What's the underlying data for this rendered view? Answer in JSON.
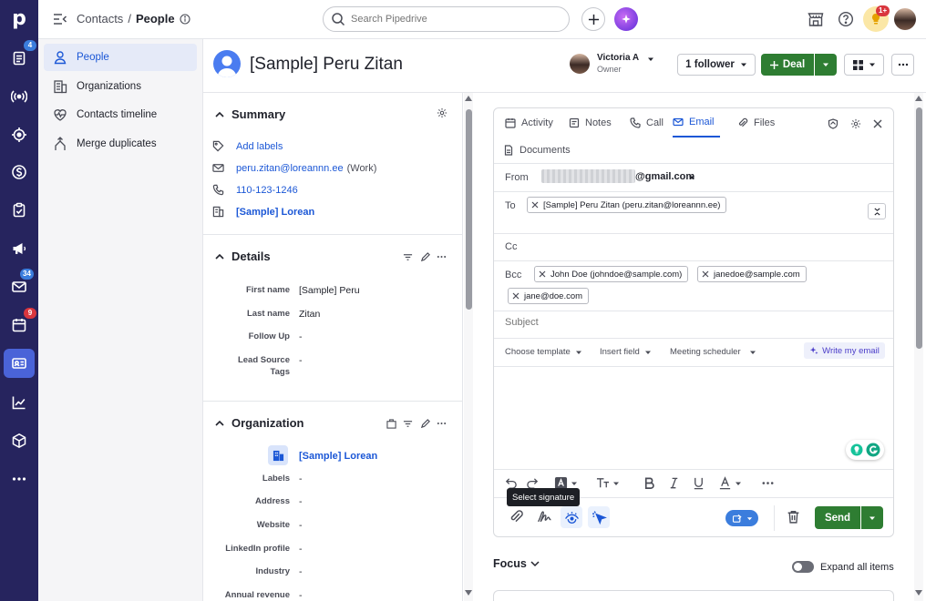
{
  "colors": {
    "rail": "#26245e",
    "accent": "#1b57d6",
    "primary_green": "#2e7d32",
    "badge_blue": "#3b7ddd",
    "badge_red": "#d9363e"
  },
  "rail": {
    "logo": "p",
    "badges": {
      "leads": "4",
      "mail": "34",
      "activities": "9"
    }
  },
  "topbar": {
    "breadcrumb_parent": "Contacts",
    "breadcrumb_sep": "/",
    "breadcrumb_current": "People",
    "search_placeholder": "Search Pipedrive",
    "notif_badge": "1+"
  },
  "subnav": {
    "items": [
      {
        "label": "People"
      },
      {
        "label": "Organizations"
      },
      {
        "label": "Contacts timeline"
      },
      {
        "label": "Merge duplicates"
      }
    ]
  },
  "header": {
    "title": "[Sample] Peru Zitan",
    "owner_name": "Victoria A",
    "owner_role": "Owner",
    "follower_label": "1 follower",
    "deal_label": "Deal"
  },
  "summary": {
    "title": "Summary",
    "add_labels": "Add labels",
    "email": "peru.zitan@loreannn.ee",
    "email_type": "(Work)",
    "phone": "110-123-1246",
    "org": "[Sample] Lorean"
  },
  "details": {
    "title": "Details",
    "fields": [
      {
        "label": "First name",
        "value": "[Sample] Peru"
      },
      {
        "label": "Last name",
        "value": "Zitan"
      },
      {
        "label": "Follow Up",
        "value": "-"
      },
      {
        "label": "Lead Source",
        "label2": "Tags",
        "value": "-"
      }
    ]
  },
  "organization": {
    "title": "Organization",
    "name": "[Sample] Lorean",
    "fields": [
      {
        "label": "Labels",
        "value": "-"
      },
      {
        "label": "Address",
        "value": "-"
      },
      {
        "label": "Website",
        "value": "-"
      },
      {
        "label": "LinkedIn profile",
        "value": "-"
      },
      {
        "label": "Industry",
        "value": "-"
      },
      {
        "label": "Annual revenue",
        "value": "-"
      }
    ]
  },
  "composer": {
    "tabs": [
      {
        "label": "Activity"
      },
      {
        "label": "Notes"
      },
      {
        "label": "Call"
      },
      {
        "label": "Email"
      },
      {
        "label": "Files"
      },
      {
        "label": "Documents"
      }
    ],
    "from_label": "From",
    "from_value": "@gmail.com",
    "to_label": "To",
    "to_chip": "[Sample] Peru Zitan (peru.zitan@loreannn.ee)",
    "cc_label": "Cc",
    "bcc_label": "Bcc",
    "bcc_chips": [
      "John Doe (johndoe@sample.com)",
      "janedoe@sample.com",
      "jane@doe.com"
    ],
    "subject_placeholder": "Subject",
    "toolbar": {
      "template": "Choose template",
      "insert": "Insert field",
      "meeting": "Meeting scheduler",
      "ai": "Write my email"
    },
    "tooltip": "Select signature",
    "send_label": "Send"
  },
  "focus": {
    "title": "Focus",
    "expand_label": "Expand all items"
  }
}
